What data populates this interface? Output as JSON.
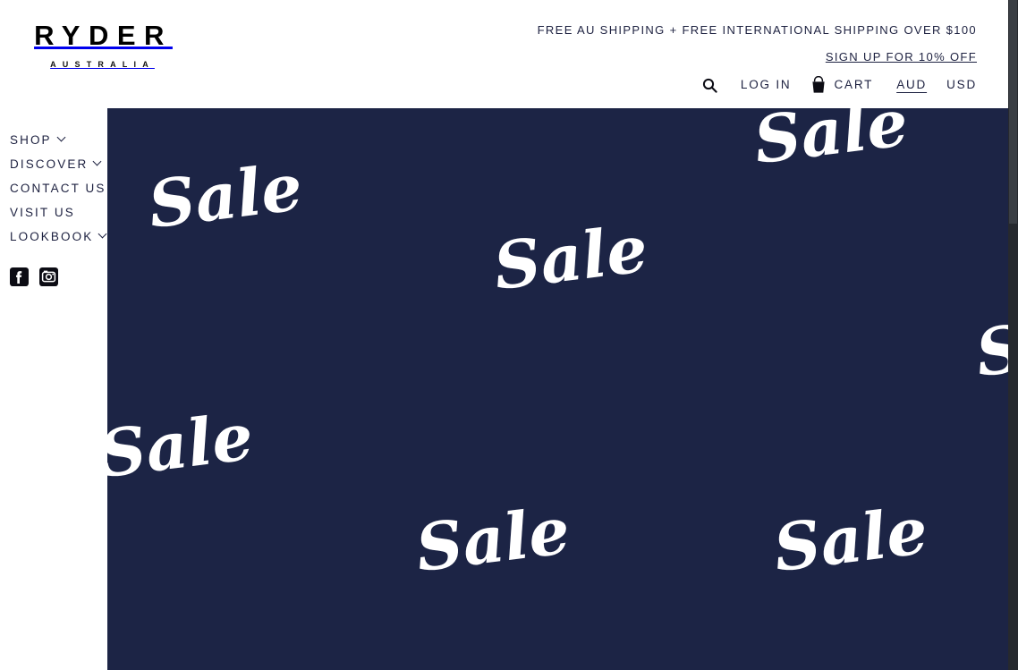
{
  "brand": {
    "name": "RYDER",
    "sub": "AUSTRALIA"
  },
  "header": {
    "announcement_1": "FREE AU SHIPPING + FREE INTERNATIONAL SHIPPING OVER $100",
    "announcement_2": "SIGN UP FOR 10% OFF",
    "search_icon": "search-icon",
    "login_label": "LOG IN",
    "cart_icon": "shopping-bag-icon",
    "cart_label": "CART",
    "currency_active": "AUD",
    "currency_alt": "USD"
  },
  "sidebar": {
    "items": [
      {
        "label": "SHOP",
        "has_chevron": true
      },
      {
        "label": "DISCOVER",
        "has_chevron": true
      },
      {
        "label": "CONTACT US",
        "has_chevron": false
      },
      {
        "label": "VISIT US",
        "has_chevron": false
      },
      {
        "label": "LOOKBOOK",
        "has_chevron": true
      }
    ],
    "social": [
      {
        "name": "facebook-icon",
        "label": "Facebook"
      },
      {
        "name": "instagram-icon",
        "label": "Instagram"
      }
    ]
  },
  "hero": {
    "background_color": "#1c2445",
    "text_color": "#ffffff",
    "words": [
      "Sale",
      "Sale",
      "Sale",
      "Sale",
      "Sale",
      "Sale",
      "Sale"
    ]
  },
  "colors": {
    "navy": "#1c2445",
    "text_navy": "#1d2140",
    "white": "#ffffff",
    "scrollbar_track": "#26292e",
    "scrollbar_thumb": "#3a3e44"
  }
}
